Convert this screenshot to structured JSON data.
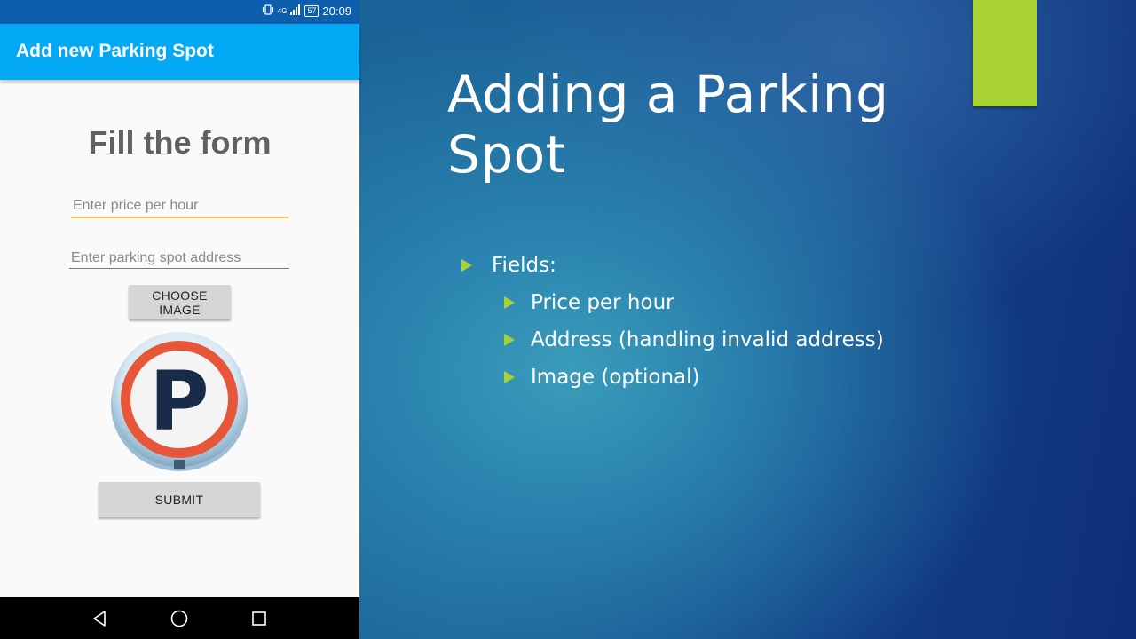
{
  "slide": {
    "title": "Adding a Parking Spot",
    "bullets": {
      "fields": "Fields:",
      "items": [
        "Price per hour",
        "Address (handling invalid address)",
        "Image (optional)"
      ]
    },
    "colors": {
      "accent": "#a8d133",
      "background": "#1a5e95"
    }
  },
  "phone": {
    "status_bar": {
      "time": "20:09",
      "battery": "57",
      "network": "4G"
    },
    "app_bar": {
      "title": "Add new Parking Spot"
    },
    "form": {
      "heading": "Fill the form",
      "price_placeholder": "Enter price per hour",
      "address_placeholder": "Enter parking spot address",
      "choose_image_label": "CHOOSE IMAGE",
      "submit_label": "SUBMIT",
      "image_letter": "P"
    },
    "nav_icons": [
      "back-icon",
      "home-icon",
      "recents-icon"
    ],
    "colors": {
      "app_bar": "#03a9f4",
      "status_bar": "#0d5fae",
      "focus_underline": "#f4c95d"
    }
  }
}
